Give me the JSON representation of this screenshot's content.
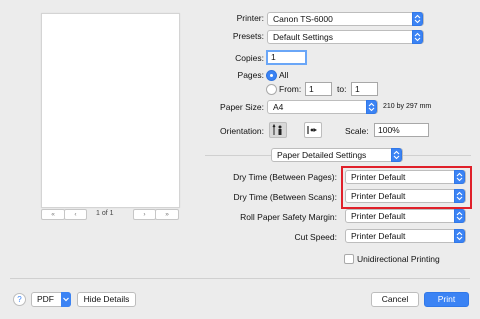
{
  "preview": {
    "page_indicator": "1 of 1"
  },
  "printer": {
    "label": "Printer:",
    "value": "Canon TS-6000"
  },
  "presets": {
    "label": "Presets:",
    "value": "Default Settings"
  },
  "copies": {
    "label": "Copies:",
    "value": "1"
  },
  "pages": {
    "label": "Pages:",
    "all_label": "All",
    "from_label": "From:",
    "from_value": "1",
    "to_label": "to:",
    "to_value": "1"
  },
  "paper_size": {
    "label": "Paper Size:",
    "value": "A4",
    "dimensions": "210 by 297 mm"
  },
  "orientation": {
    "label": "Orientation:"
  },
  "scale": {
    "label": "Scale:",
    "value": "100%"
  },
  "section": {
    "value": "Paper Detailed Settings"
  },
  "dry_time_pages": {
    "label": "Dry Time (Between Pages):",
    "value": "Printer Default"
  },
  "dry_time_scans": {
    "label": "Dry Time (Between Scans):",
    "value": "Printer Default"
  },
  "roll_paper": {
    "label": "Roll Paper Safety Margin:",
    "value": "Printer Default"
  },
  "cut_speed": {
    "label": "Cut Speed:",
    "value": "Printer Default"
  },
  "unidirectional": {
    "label": "Unidirectional Printing"
  },
  "footer": {
    "help": "?",
    "pdf_label": "PDF",
    "hide_details": "Hide Details",
    "cancel": "Cancel",
    "print": "Print"
  },
  "colors": {
    "accent": "#3b83f4",
    "highlight": "#e0202a"
  }
}
